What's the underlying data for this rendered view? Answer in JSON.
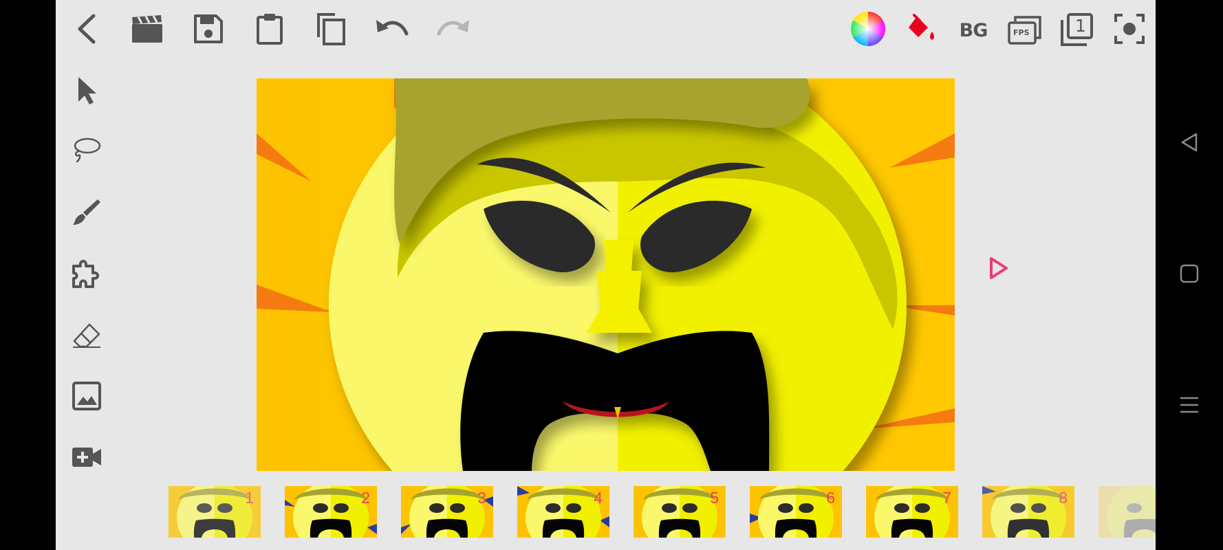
{
  "toolbar": {
    "background_label": "BG",
    "fps_label": "FPS",
    "layer_number": "1"
  },
  "frames": [
    {
      "number": "1"
    },
    {
      "number": "2"
    },
    {
      "number": "3"
    },
    {
      "number": "4"
    },
    {
      "number": "5"
    },
    {
      "number": "6"
    },
    {
      "number": "7"
    },
    {
      "number": "8"
    }
  ],
  "colors": {
    "toolbar_icon": "#555555",
    "app_background": "#e7e7e7",
    "accent_pink": "#e8405a",
    "bucket_red": "#e8001c",
    "play_pink": "#ec3a7a"
  },
  "icons": {
    "top": [
      "back-icon",
      "movie-clapper-icon",
      "save-icon",
      "clipboard-icon",
      "copy-icon",
      "undo-icon",
      "redo-icon",
      "color-wheel-icon",
      "paint-bucket-icon",
      "background-icon",
      "fps-icon",
      "layer-icon",
      "screenshot-icon"
    ],
    "left": [
      "select-arrow-icon",
      "lasso-icon",
      "brush-icon",
      "puzzle-icon",
      "eraser-icon",
      "image-icon",
      "add-video-icon"
    ],
    "system": [
      "nav-back-icon",
      "nav-home-icon",
      "nav-menu-icon"
    ]
  }
}
